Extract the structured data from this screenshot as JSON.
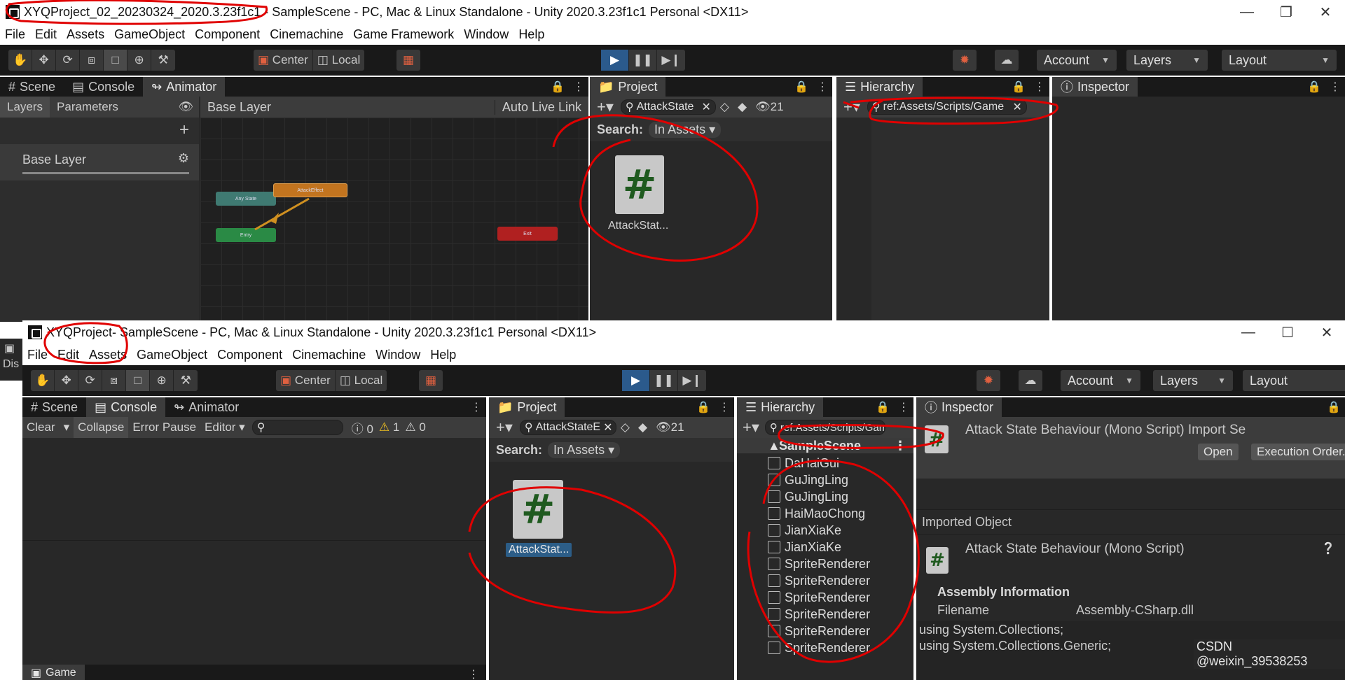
{
  "window1": {
    "title": "XYQProject_02_20230324_2020.3.23f1c1 - SampleScene - PC, Mac & Linux Standalone - Unity 2020.3.23f1c1 Personal <DX11>",
    "menu": [
      "File",
      "Edit",
      "Assets",
      "GameObject",
      "Component",
      "Cinemachine",
      "Game Framework",
      "Window",
      "Help"
    ],
    "toolbar": {
      "center_label": "Center",
      "local_label": "Local",
      "account_label": "Account",
      "layers_label": "Layers",
      "layout_label": "Layout"
    },
    "animator": {
      "tabs": [
        "Scene",
        "Console",
        "Animator"
      ],
      "left_tabs": [
        "Layers",
        "Parameters"
      ],
      "base_layer_item": "Base Layer",
      "breadcrumb": "Base Layer",
      "auto_live_link": "Auto Live Link",
      "nodes": {
        "any_state": "Any State",
        "attack_effect": "AttackEffect",
        "entry": "Entry",
        "exit": "Exit"
      }
    },
    "project": {
      "tab": "Project",
      "search_value": "AttackState",
      "search_label": "Search:",
      "in_assets": "In Assets",
      "hidden_count": "21",
      "asset_name": "AttackStat..."
    },
    "hierarchy": {
      "tab": "Hierarchy",
      "search_value": "ref:Assets/Scripts/Game"
    },
    "inspector": {
      "tab": "Inspector"
    }
  },
  "window2": {
    "title_project": "XYQProject",
    "title_rest": " - SampleScene - PC, Mac & Linux Standalone - Unity 2020.3.23f1c1 Personal <DX11>",
    "menu": [
      "File",
      "Edit",
      "Assets",
      "GameObject",
      "Component",
      "Cinemachine",
      "Window",
      "Help"
    ],
    "toolbar": {
      "center_label": "Center",
      "local_label": "Local",
      "account_label": "Account",
      "layers_label": "Layers",
      "layout_label": "Layout"
    },
    "console": {
      "tabs": [
        "Scene",
        "Console",
        "Animator"
      ],
      "clear": "Clear",
      "collapse": "Collapse",
      "error_pause": "Error Pause",
      "editor": "Editor",
      "counts": {
        "info": "0",
        "warn": "1",
        "error": "0"
      },
      "game_tab": "Game"
    },
    "project": {
      "tab": "Project",
      "search_value": "AttackStateE",
      "search_label": "Search:",
      "in_assets": "In Assets",
      "hidden_count": "21",
      "asset_name": "AttackStat..."
    },
    "hierarchy": {
      "tab": "Hierarchy",
      "search_value": "ref:Assets/Scripts/Game",
      "scene": "SampleScene",
      "items": [
        "DaHaiGui",
        "GuJingLing",
        "GuJingLing",
        "HaiMaoChong",
        "JianXiaKe",
        "JianXiaKe",
        "SpriteRenderer",
        "SpriteRenderer",
        "SpriteRenderer",
        "SpriteRenderer",
        "SpriteRenderer",
        "SpriteRenderer"
      ]
    },
    "inspector": {
      "tab": "Inspector",
      "header": "Attack State Behaviour (Mono Script) Import Se",
      "open": "Open",
      "exec_order": "Execution Order...",
      "imported_object": "Imported Object",
      "object_title": "Attack State Behaviour (Mono Script)",
      "assembly_info": "Assembly Information",
      "filename_label": "Filename",
      "filename_value": "Assembly-CSharp.dll",
      "code": [
        "using System.Collections;",
        "using System.Collections.Generic;"
      ],
      "watermark": "CSDN @weixin_39538253"
    }
  },
  "side_fragments": {
    "dis": "Dis"
  },
  "colors": {
    "accent": "#2b5a8c",
    "annotation": "#e00000",
    "editor_bg": "#282828",
    "toolbar_bg": "#191919",
    "csharp_green": "#1f5a1f"
  }
}
